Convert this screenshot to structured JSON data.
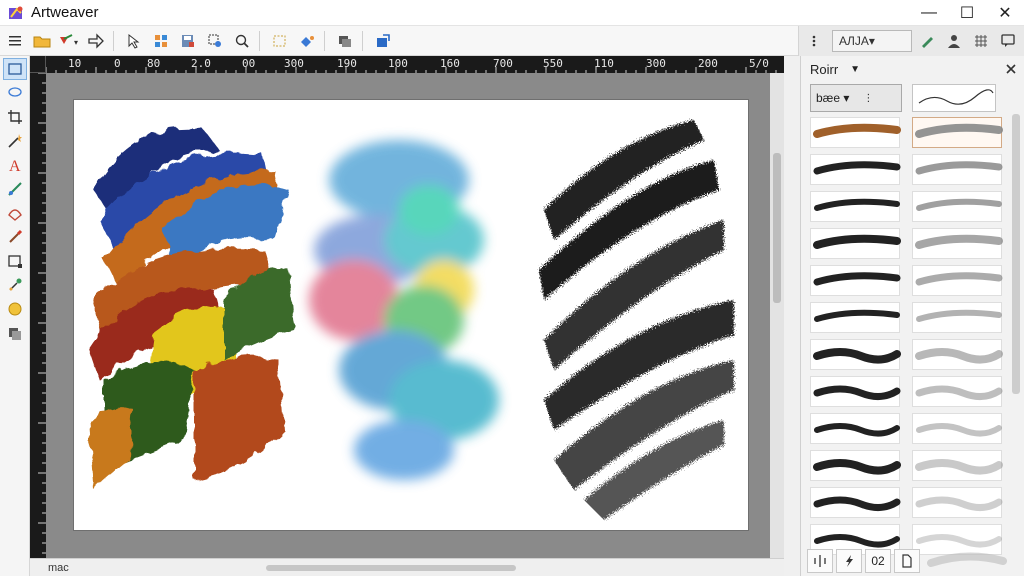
{
  "window": {
    "title": "Artweaver",
    "minimize_glyph": "—",
    "maximize_glyph": "☐",
    "close_glyph": "✕"
  },
  "toolbar": {
    "preset_label": "AЛJA▾",
    "icons": [
      "menu-icon",
      "open-folder-icon",
      "brush-dropdown-icon",
      "arrow-icon",
      "select-icon",
      "grid-icon",
      "save-icon",
      "zoom-select-icon",
      "zoom-icon",
      "marquee-icon",
      "paint-bucket-icon",
      "layers-icon",
      "export-icon"
    ],
    "right_icons": [
      "brush-tip-icon",
      "pen-icon",
      "user-icon",
      "grid-pattern-icon",
      "chat-icon"
    ]
  },
  "rulers": {
    "top_labels": [
      "10",
      "0",
      "80",
      "2.0",
      "00",
      "300",
      "190",
      "100",
      "160",
      "700",
      "550",
      "110",
      "300",
      "200",
      "5/0"
    ]
  },
  "status": {
    "zoom_text": "mac"
  },
  "brush_panel": {
    "title": "Roirr",
    "category": "bæe ▾",
    "footer_value": "02",
    "colors": {
      "accent": "#cfe3f7",
      "selected_border": "#d3aa86"
    }
  }
}
